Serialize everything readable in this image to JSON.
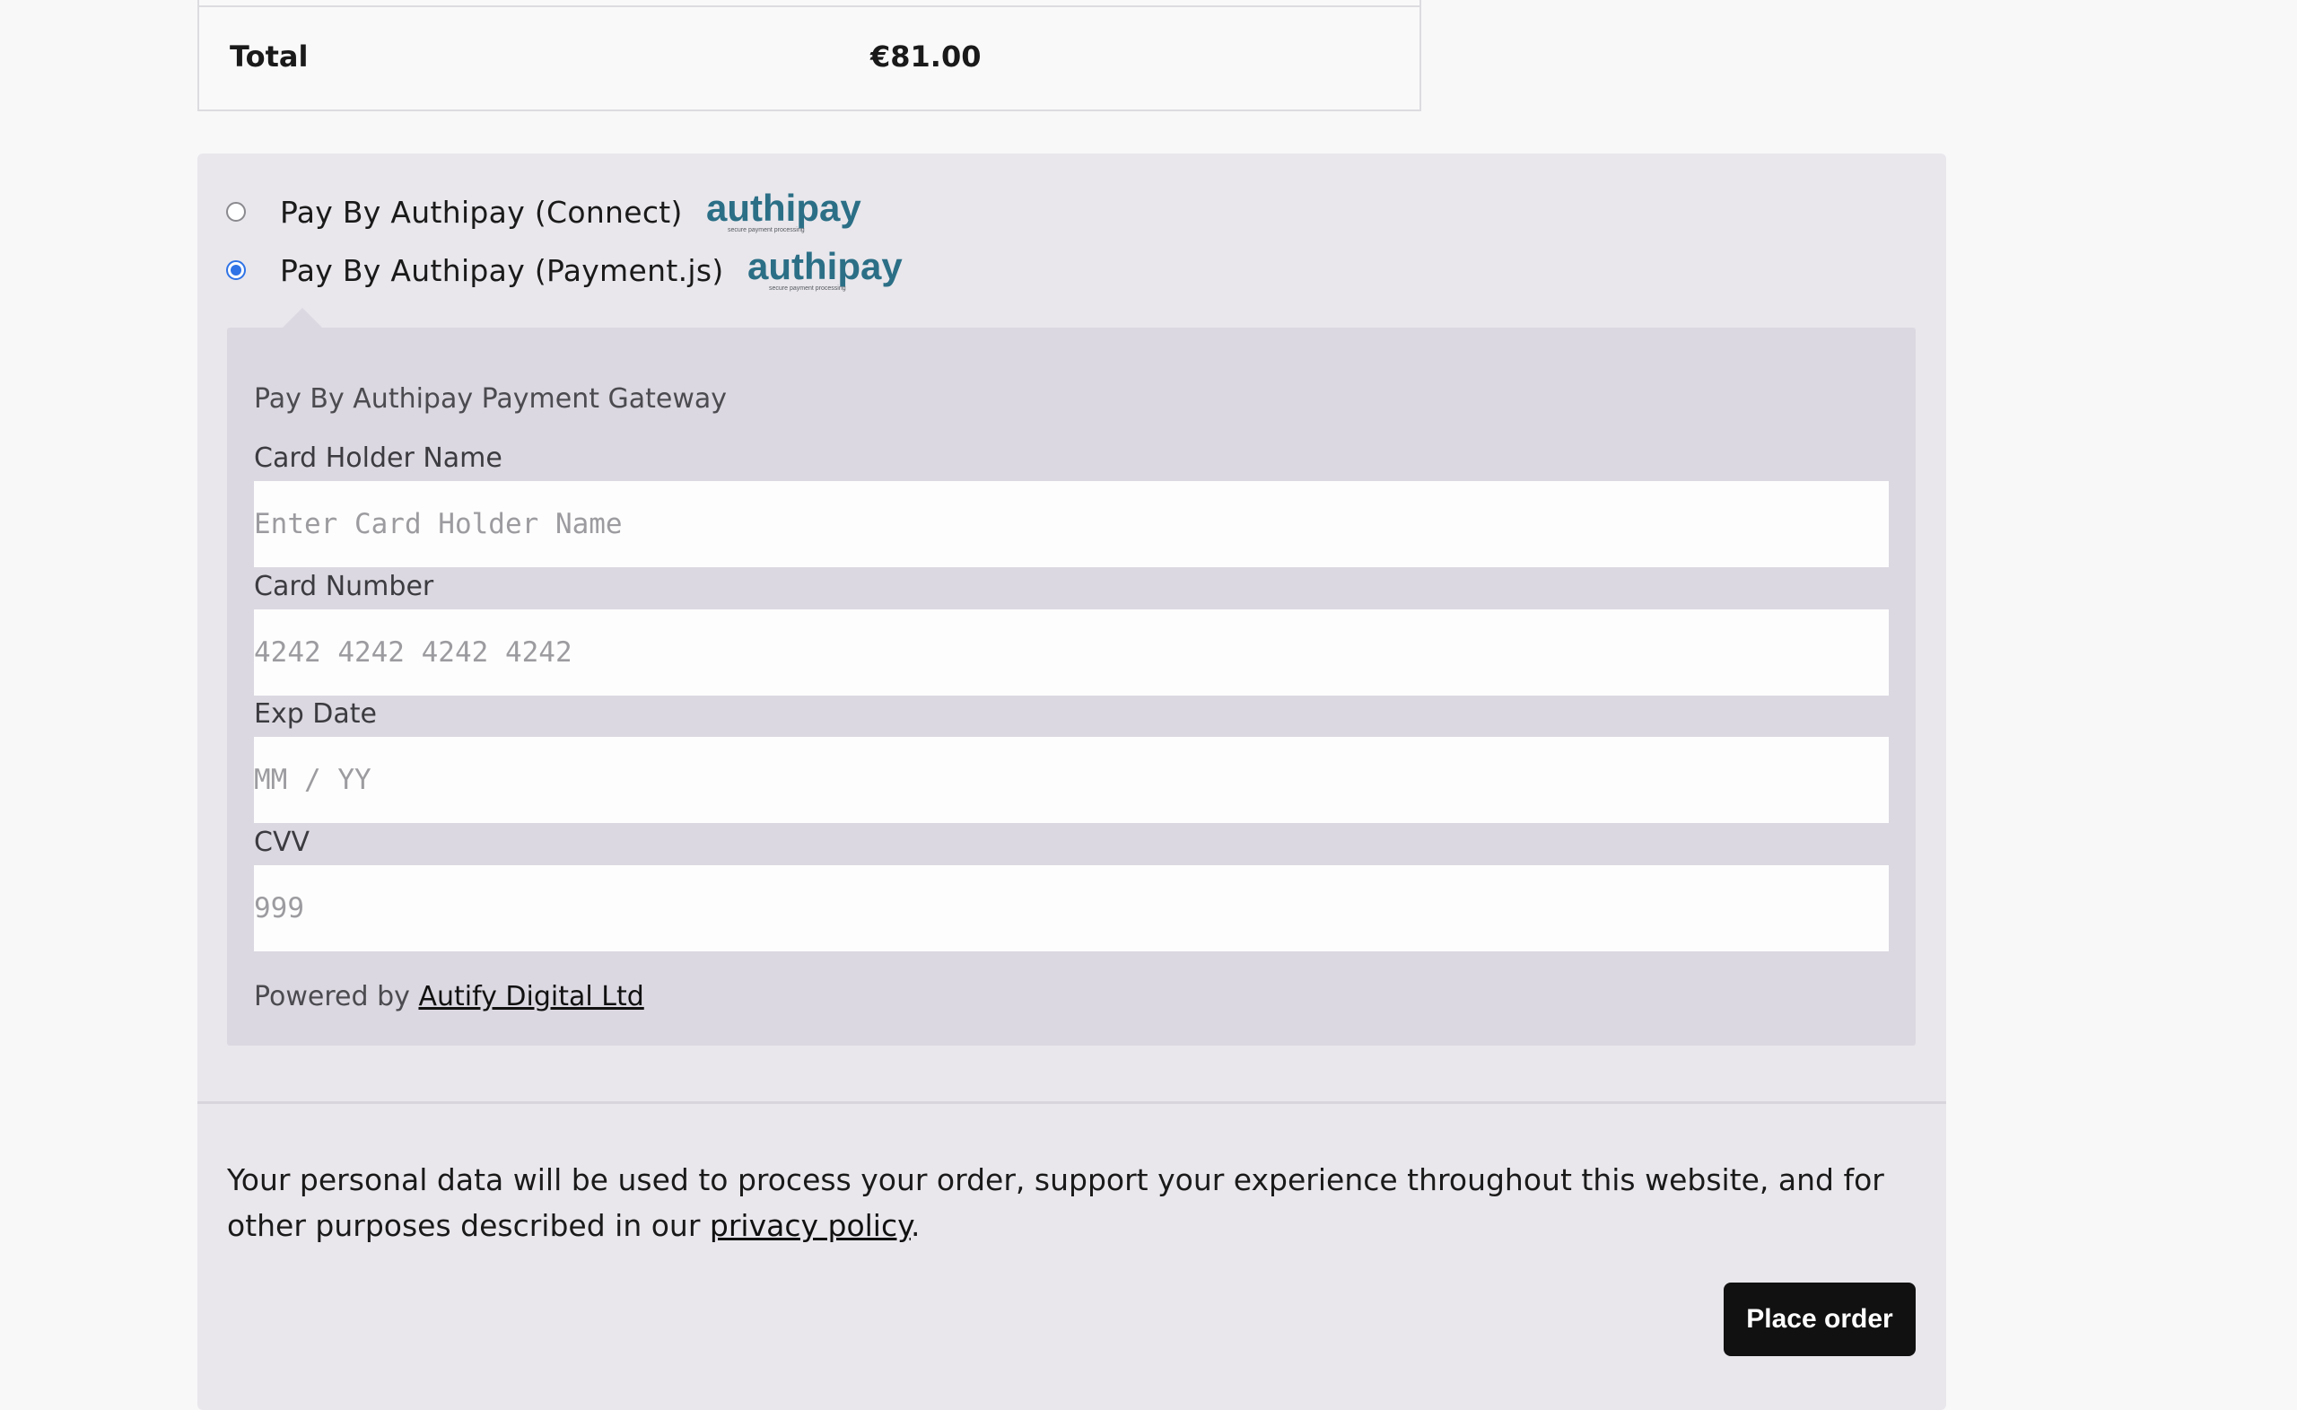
{
  "order_totals": {
    "total_label": "Total",
    "total_amount": "€81.00"
  },
  "payment_methods": [
    {
      "label": "Pay By Authipay (Connect)",
      "selected": false,
      "logo_text": "authipay",
      "logo_tagline": "secure payment processing"
    },
    {
      "label": "Pay By Authipay (Payment.js)",
      "selected": true,
      "logo_text": "authipay",
      "logo_tagline": "secure payment processing"
    }
  ],
  "payment_box": {
    "description": "Pay By Authipay Payment Gateway",
    "fields": {
      "card_holder": {
        "label": "Card Holder Name",
        "placeholder": "Enter Card Holder Name",
        "value": ""
      },
      "card_number": {
        "label": "Card Number",
        "placeholder": "4242 4242 4242 4242",
        "value": ""
      },
      "exp_date": {
        "label": "Exp Date",
        "placeholder": "MM / YY",
        "value": ""
      },
      "cvv": {
        "label": "CVV",
        "placeholder": "999",
        "value": ""
      }
    },
    "powered_by_prefix": "Powered by",
    "powered_by_link": "Autify Digital Ltd"
  },
  "privacy_notice": {
    "text": "Your personal data will be used to process your order, support your experience throughout this website, and for other purposes described in our",
    "link_text": "privacy policy",
    "suffix": "."
  },
  "place_order_label": "Place order",
  "colors": {
    "panel_background": "#e9e7ec",
    "box_background": "#dcd8e1",
    "radio_selected": "#2f73e6",
    "logo_teal": "#2b6f86",
    "button_background": "#111111"
  }
}
